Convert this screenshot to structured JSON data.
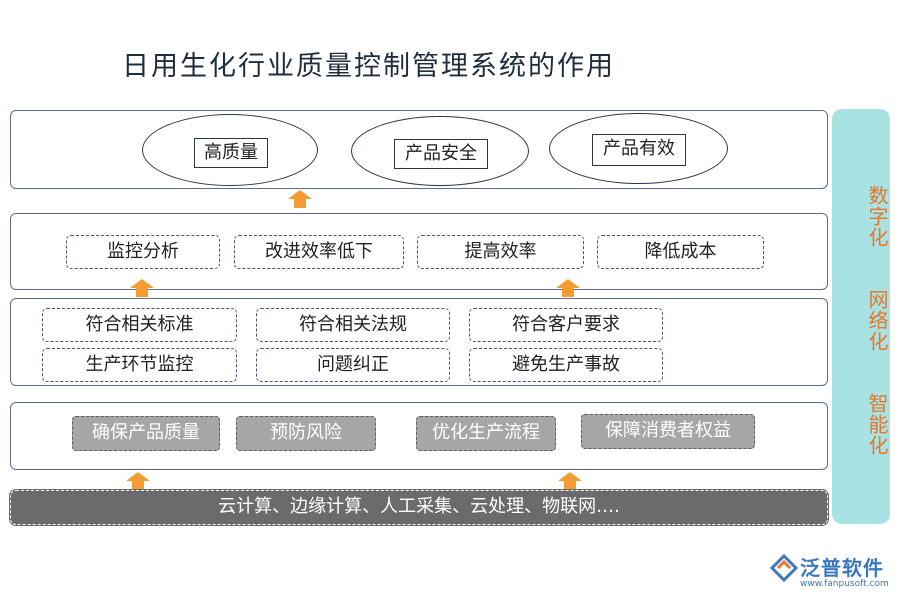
{
  "title": "日用生化行业质量控制管理系统的作用",
  "goals": [
    "高质量",
    "产品安全",
    "产品有效"
  ],
  "benefits": [
    "监控分析",
    "改进效率低下",
    "提高效率",
    "降低成本"
  ],
  "compliance_row1": [
    "符合相关标准",
    "符合相关法规",
    "符合客户要求"
  ],
  "compliance_row2": [
    "生产环节监控",
    "问题纠正",
    "避免生产事故"
  ],
  "functions": [
    "确保产品质量",
    "预防风险",
    "优化生产流程",
    "保障消费者权益"
  ],
  "technologies": "云计算、边缘计算、人工采集、云处理、物联网….",
  "side": [
    "数字化",
    "网络化",
    "智能化"
  ],
  "logo": {
    "name": "泛普软件",
    "url": "www.fanpusoft.com"
  },
  "colors": {
    "arrow": "#f39c33",
    "side_bg": "#a9e2e2",
    "side_text": "#e8762b",
    "tech_bar": "#6b6b6b",
    "function_box": "#a6a6a6"
  }
}
